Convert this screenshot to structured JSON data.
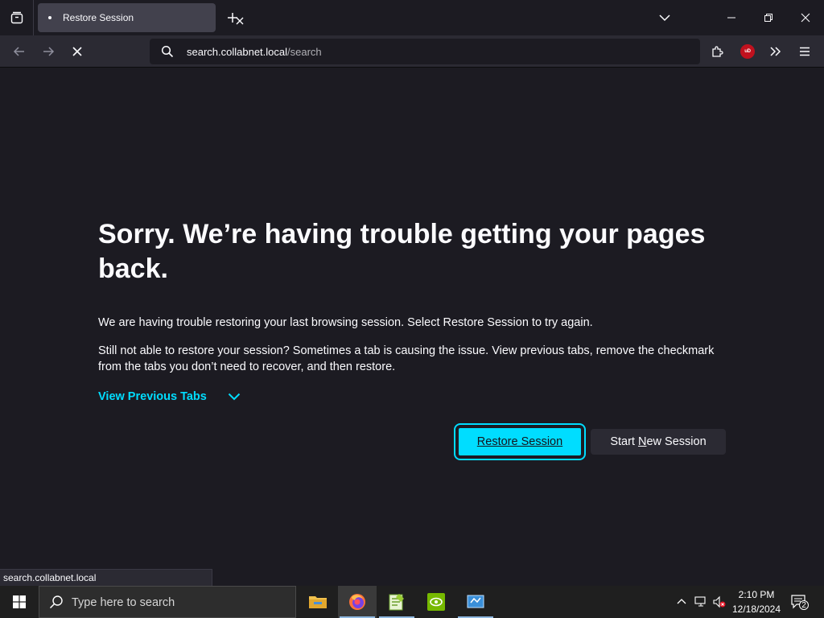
{
  "browser": {
    "tab": {
      "title": "Restore Session"
    },
    "url": {
      "host": "search.collabnet.local",
      "path": "/search"
    },
    "ublock_label": "uD"
  },
  "page": {
    "headline": "Sorry. We’re having trouble getting your pages back.",
    "para1": "We are having trouble restoring your last browsing session. Select Restore Session to try again.",
    "para2": "Still not able to restore your session? Sometimes a tab is causing the issue. View previous tabs, remove the checkmark from the tabs you don’t need to recover, and then restore.",
    "view_previous_tabs": "View Previous Tabs",
    "restore_button": "Restore Session",
    "new_session_button": {
      "before": "Start ",
      "accel": "N",
      "after": "ew Session"
    }
  },
  "status_bar": {
    "url": "search.collabnet.local"
  },
  "taskbar": {
    "search_placeholder": "Type here to search",
    "time": "2:10 PM",
    "date": "12/18/2024",
    "notification_count": "2"
  },
  "colors": {
    "accent": "#00ddff",
    "background": "#1c1b22",
    "toolbar": "#2b2a33"
  }
}
